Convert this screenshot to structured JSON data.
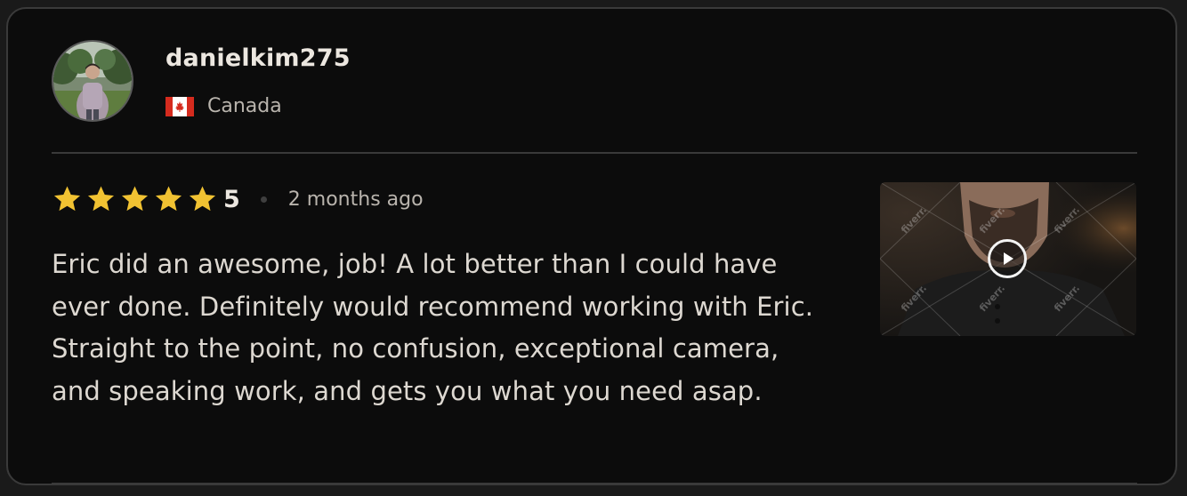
{
  "review": {
    "username": "danielkim275",
    "country": "Canada",
    "rating": "5",
    "stars_filled": 5,
    "time_ago": "2 months ago",
    "text": "Eric did an awesome, job! A lot better than I could have ever done. Definitely would recommend working with Eric. Straight to the point, no confusion, exceptional camera, and speaking work, and gets you what you need asap.",
    "video_watermark": "fiverr."
  },
  "icons": {
    "star": "star-icon",
    "play": "play-icon",
    "flag": "canada-flag-icon"
  },
  "colors": {
    "card_background": "#0c0c0c",
    "border": "#3a3a3a",
    "star": "#f1c232",
    "text_primary": "#ece7e0",
    "text_secondary": "#b9b4ad"
  }
}
